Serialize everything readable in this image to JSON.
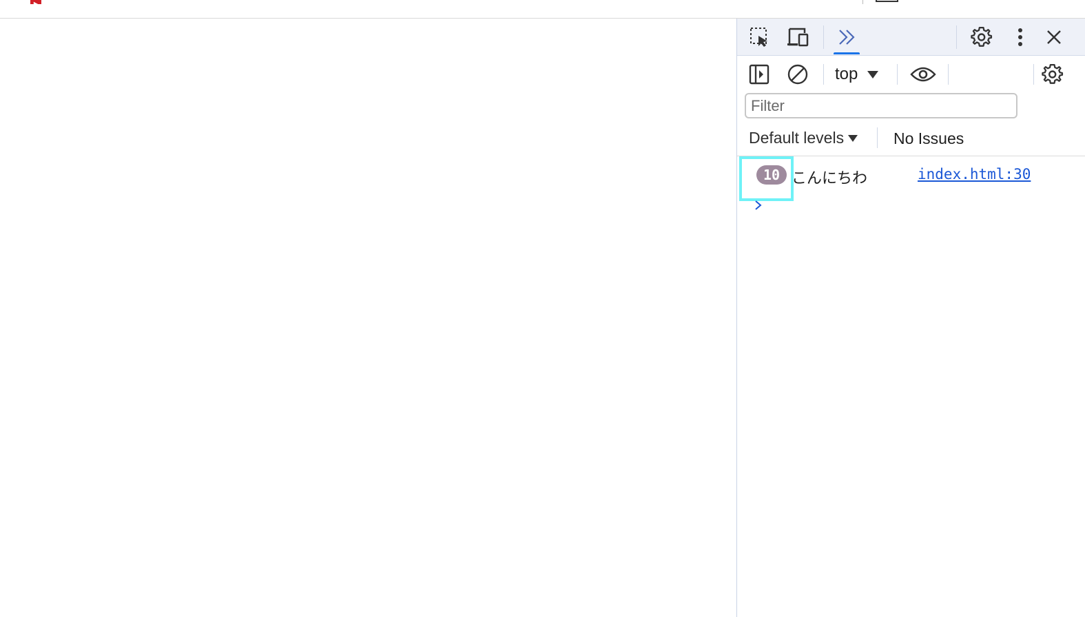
{
  "devtools": {
    "toolbar": {
      "inspect_icon": "inspect-element-icon",
      "device_icon": "device-toolbar-icon",
      "more_tabs_icon": "chevron-double-right-icon",
      "settings_icon": "gear-icon",
      "menu_icon": "kebab-menu-icon",
      "close_icon": "close-icon",
      "active_tab_color": "#1a73e8"
    },
    "console_toolbar": {
      "sidebar_icon": "sidebar-toggle-icon",
      "clear_icon": "clear-console-icon",
      "context_label": "top",
      "live_expression_icon": "eye-icon",
      "settings_icon": "gear-icon"
    },
    "filter": {
      "placeholder": "Filter",
      "value": ""
    },
    "levels": {
      "label": "Default levels",
      "issues": "No Issues"
    },
    "log_entries": [
      {
        "repeat_count": "10",
        "message": "こんにちわ",
        "source": "index.html:30",
        "badge_color": "#9e8a9d"
      }
    ],
    "highlight_color": "#6ff2f7",
    "prompt_icon": "chevron-right-icon"
  }
}
